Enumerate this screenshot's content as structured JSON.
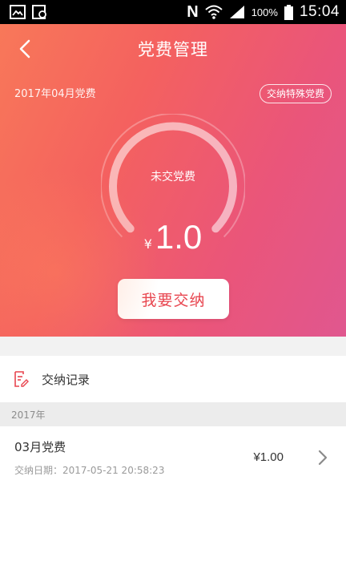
{
  "status_bar": {
    "battery_text": "100%",
    "time": "15:04",
    "nfc_label": "N"
  },
  "nav": {
    "title": "党费管理"
  },
  "hero": {
    "period": "2017年04月党费",
    "special_fee_label": "交纳特殊党费",
    "gauge_label": "未交党费",
    "currency": "¥",
    "amount": "1.0",
    "pay_button_label": "我要交纳"
  },
  "records": {
    "title": "交纳记录",
    "year": "2017年",
    "items": [
      {
        "month": "03月党费",
        "date": "交纳日期：2017-05-21 20:58:23",
        "amount": "¥1.00"
      }
    ]
  },
  "colors": {
    "accent": "#e8454f",
    "gradient_start": "#f87859",
    "gradient_end": "#e0578f"
  },
  "icons": {
    "back": "chevron-left-icon",
    "record": "document-icon",
    "row_chevron": "chevron-right-icon"
  }
}
